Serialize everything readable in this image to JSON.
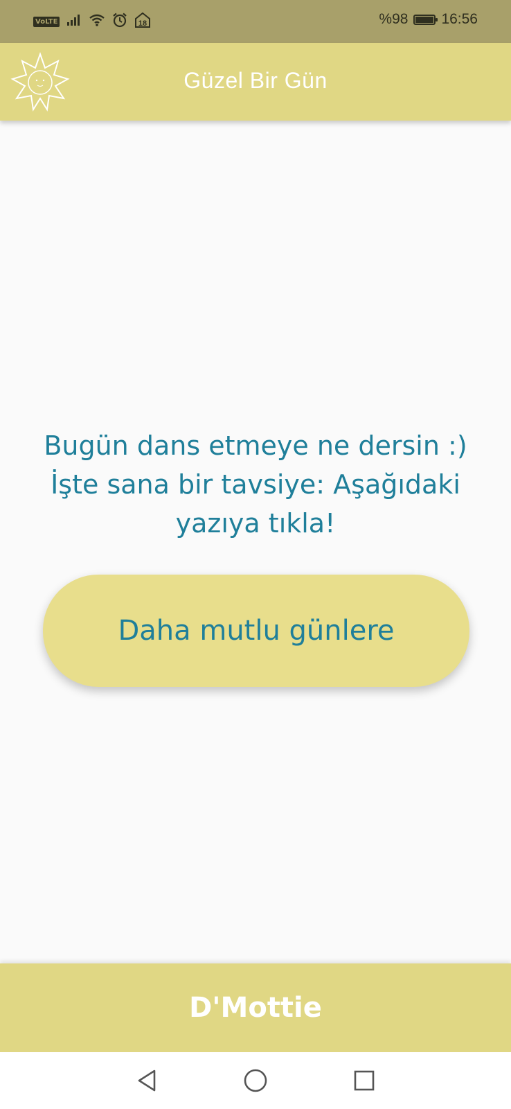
{
  "status_bar": {
    "network_badge": "VoLTE",
    "notification_count": "18",
    "battery_text": "%98",
    "battery_level": 0.98,
    "time": "16:56",
    "icons": [
      "signal-icon",
      "wifi-icon",
      "alarm-icon",
      "notification-icon",
      "battery-icon"
    ]
  },
  "app_bar": {
    "title": "Güzel Bir Gün",
    "logo_icon": "sun-logo-icon",
    "background": "#e0d784"
  },
  "main": {
    "message": "Bugün dans etmeye ne dersin :) İşte sana bir tavsiye: Aşağıdaki yazıya tıkla!",
    "button_label": "Daha mutlu günlere",
    "text_color": "#1f7f9a",
    "button_color": "#e8de8c"
  },
  "footer": {
    "label": "D'Mottie"
  },
  "nav_bar": {
    "buttons": [
      "back-icon",
      "home-icon",
      "recents-icon"
    ]
  }
}
